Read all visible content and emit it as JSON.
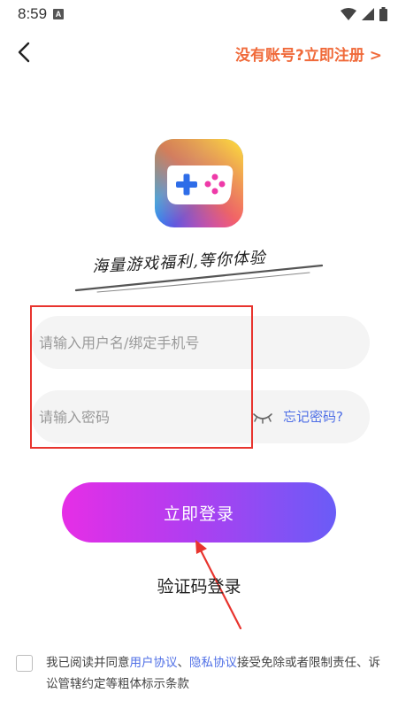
{
  "status_bar": {
    "time": "8:59",
    "badge": "A",
    "icons": [
      "wifi-icon",
      "signal-icon",
      "battery-icon"
    ]
  },
  "header": {
    "back_icon": "chevron-left-icon",
    "register_link": "没有账号?立即注册 >"
  },
  "branding": {
    "logo_icon": "gamepad-icon",
    "slogan": "海量游戏福利,等你体验"
  },
  "form": {
    "username_placeholder": "请输入用户名/绑定手机号",
    "username_value": "",
    "password_placeholder": "请输入密码",
    "password_value": "",
    "eye_icon": "eye-closed-icon",
    "forgot_password": "忘记密码?",
    "login_button": "立即登录",
    "code_login": "验证码登录"
  },
  "agreement": {
    "prefix": "我已阅读并同意",
    "user_agreement": "用户协议",
    "separator": "、",
    "privacy_agreement": "隐私协议",
    "suffix": "接受免除或者限制责任、诉讼管辖约定等粗体标示条款"
  },
  "colors": {
    "accent_orange": "#f06a3a",
    "link_blue": "#4f6fe6",
    "annotation_red": "#e8342e",
    "button_gradient_start": "#e62ee6",
    "button_gradient_end": "#6a5cf7"
  }
}
